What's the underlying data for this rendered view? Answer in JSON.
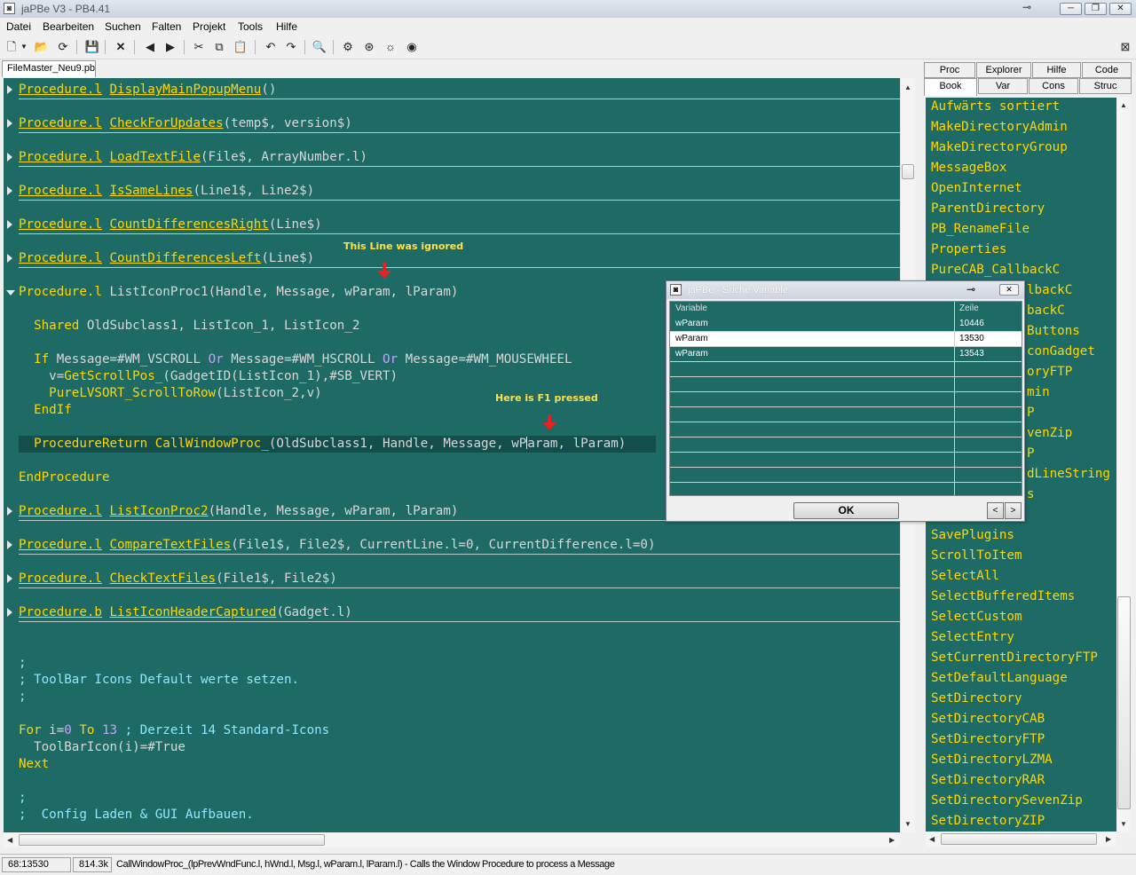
{
  "window": {
    "title": "jaPBe V3 - PB4.41",
    "icon": "app-icon",
    "buttons": {
      "minimize": "─",
      "maximize": "❐",
      "close": "✕"
    }
  },
  "menu": [
    "Datei",
    "Bearbeiten",
    "Suchen",
    "Falten",
    "Projekt",
    "Tools",
    "Hilfe"
  ],
  "toolbar_icons": [
    "new-file-icon",
    "dropdown-icon",
    "open-file-icon",
    "reload-icon",
    "save-icon",
    "close-file-icon",
    "back-icon",
    "forward-icon",
    "cut-icon",
    "copy-icon",
    "paste-icon",
    "undo-icon",
    "redo-icon",
    "search-icon",
    "settings-icon",
    "compile-icon",
    "debug-icon",
    "help-icon"
  ],
  "file_tab": "FileMaster_Neu9.pb",
  "editor": {
    "lines": [
      {
        "kw": "Procedure.l",
        "name": "DisplayMainPopupMenu",
        "args": "()"
      },
      {
        "kw": "Procedure.l",
        "name": "CheckForUpdates",
        "args": "(temp$, version$)"
      },
      {
        "kw": "Procedure.l",
        "name": "LoadTextFile",
        "args": "(File$, ArrayNumber.l)"
      },
      {
        "kw": "Procedure.l",
        "name": "IsSameLines",
        "args": "(Line1$, Line2$)"
      },
      {
        "kw": "Procedure.l",
        "name": "CountDifferencesRight",
        "args": "(Line$)"
      },
      {
        "kw": "Procedure.l",
        "name": "CountDifferencesLeft",
        "args": "(Line$)"
      },
      {
        "kw": "Procedure.l",
        "name": "ListIconProc1",
        "args": "(Handle, Message, wParam, lParam)"
      }
    ],
    "body": {
      "shared_kw": "Shared",
      "shared_rest": " OldSubclass1, ListIcon_1, ListIcon_2",
      "if_kw": "If",
      "if_a": " Message=#WM_VSCROLL ",
      "or1": "Or",
      "if_b": " Message=#WM_HSCROLL ",
      "or2": "Or",
      "if_c": " Message=#WM_MOUSEWHEEL",
      "v_assign": "v=",
      "v_fn": "GetScrollPos_",
      "v_args": "(GadgetID(ListIcon_1),#SB_VERT)",
      "sort_fn": "PureLVSORT_ScrollToRow",
      "sort_args": "(ListIcon_2,v)",
      "endif_kw": "EndIf",
      "ret_kw": "ProcedureReturn",
      "ret_fn": "CallWindowProc_",
      "ret_args_a": "(OldSubclass1, Handle, Message, wP",
      "ret_args_b": "aram, lParam)",
      "endproc_kw": "EndProcedure"
    },
    "after_lines": [
      {
        "kw": "Procedure.l",
        "name": "ListIconProc2",
        "args": "(Handle, Message, wParam, lParam)"
      },
      {
        "kw": "Procedure.l",
        "name": "CompareTextFiles",
        "args": "(File1$, File2$, CurrentLine.l=0, CurrentDifference.l=0)"
      },
      {
        "kw": "Procedure.l",
        "name": "CheckTextFiles",
        "args": "(File1$, File2$)"
      },
      {
        "kw": "Procedure.b",
        "name": "ListIconHeaderCaptured",
        "args": "(Gadget.l)"
      }
    ],
    "tail": {
      "c1": ";",
      "c2": "; ToolBar Icons Default werte setzen.",
      "c3": ";",
      "for_kw": "For",
      "for_a": " i=",
      "for_n0": "0",
      "for_to": " To ",
      "for_n13": "13",
      "for_cm": " ; Derzeit 14 Standard-Icons",
      "toolbar_line": "ToolBarIcon(i)=#True",
      "next_kw": "Next",
      "c4": ";",
      "c5": ";  Config Laden & GUI Aufbauen."
    },
    "annotations": {
      "ignored": "This Line was ignored",
      "f1": "Here is F1 pressed"
    },
    "annotation_color": "#ffe04a",
    "arrow_color": "#e82020",
    "background": "#1e6a64"
  },
  "right_tabs": {
    "row1": [
      "Proc",
      "Explorer",
      "Hilfe",
      "Code"
    ],
    "row2": [
      "Book",
      "Var",
      "Cons",
      "Struc"
    ],
    "active": "Book"
  },
  "right_list": {
    "items_top": [
      "Aufwärts sortiert",
      "MakeDirectoryAdmin",
      "MakeDirectoryGroup",
      "MessageBox",
      "OpenInternet",
      "ParentDirectory",
      "PB_RenameFile",
      "Properties",
      "PureCAB_CallbackC"
    ],
    "items_partial": [
      "lbackC",
      "backC",
      "Buttons",
      "conGadget",
      "oryFTP",
      "min",
      "P",
      "venZip",
      "P",
      "dLineString",
      "s"
    ],
    "items_bottom": [
      "SavePlugins",
      "ScrollToItem",
      "SelectAll",
      "SelectBufferedItems",
      "SelectCustom",
      "SelectEntry",
      "SetCurrentDirectoryFTP",
      "SetDefaultLanguage",
      "SetDirectory",
      "SetDirectoryCAB",
      "SetDirectoryFTP",
      "SetDirectoryLZMA",
      "SetDirectoryRAR",
      "SetDirectorySevenZip",
      "SetDirectoryZIP"
    ]
  },
  "dialog": {
    "title": "jaPBe - Suche Variable",
    "col_variable": "Variable",
    "col_line": "Zeile",
    "rows": [
      {
        "var": "wParam",
        "line": "10446"
      },
      {
        "var": "wParam",
        "line": "13530",
        "selected": true
      },
      {
        "var": "wParam",
        "line": "13543"
      }
    ],
    "ok": "OK",
    "prev": "<",
    "next": ">"
  },
  "status": {
    "position": "68:13530",
    "size": "814.3k",
    "help": "CallWindowProc_(lpPrevWndFunc.l, hWnd.l, Msg.l, wParam.l, lParam.l) - Calls the Window Procedure to process a Message"
  }
}
